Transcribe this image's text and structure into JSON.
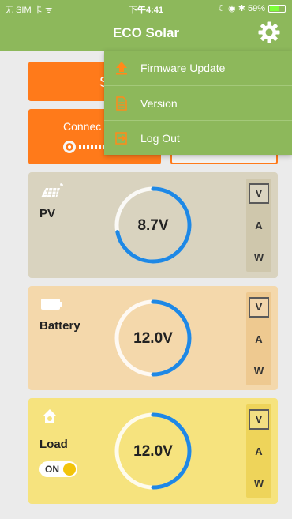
{
  "status_bar": {
    "carrier": "无 SIM 卡 ᯤ",
    "time": "下午4:41",
    "right": "☾ ◉ ✱ 59%"
  },
  "header": {
    "title": "ECO Solar",
    "settings_icon": "gear-icon"
  },
  "buttons": {
    "scan_label_partial": "S",
    "connect_label_partial": "Connec"
  },
  "menu": {
    "items": [
      {
        "label": "Firmware Update",
        "icon": "upload-icon"
      },
      {
        "label": "Version",
        "icon": "document-icon"
      },
      {
        "label": "Log Out",
        "icon": "logout-icon"
      }
    ]
  },
  "cards": {
    "pv": {
      "name": "PV",
      "reading": "8.7V",
      "icon": "solar-panel-icon",
      "arc_fraction": 0.72,
      "units": [
        "V",
        "A",
        "W"
      ],
      "active_unit": "V"
    },
    "battery": {
      "name": "Battery",
      "reading": "12.0V",
      "icon": "battery-icon",
      "arc_fraction": 0.5,
      "units": [
        "V",
        "A",
        "W"
      ],
      "active_unit": "V"
    },
    "load": {
      "name": "Load",
      "reading": "12.0V",
      "icon": "home-icon",
      "arc_fraction": 0.5,
      "switch_label": "ON",
      "units": [
        "V",
        "A",
        "W"
      ],
      "active_unit": "V"
    }
  },
  "colors": {
    "header": "#8db85b",
    "accent_orange": "#ff7a1a",
    "arc_blue": "#1e88e5"
  }
}
